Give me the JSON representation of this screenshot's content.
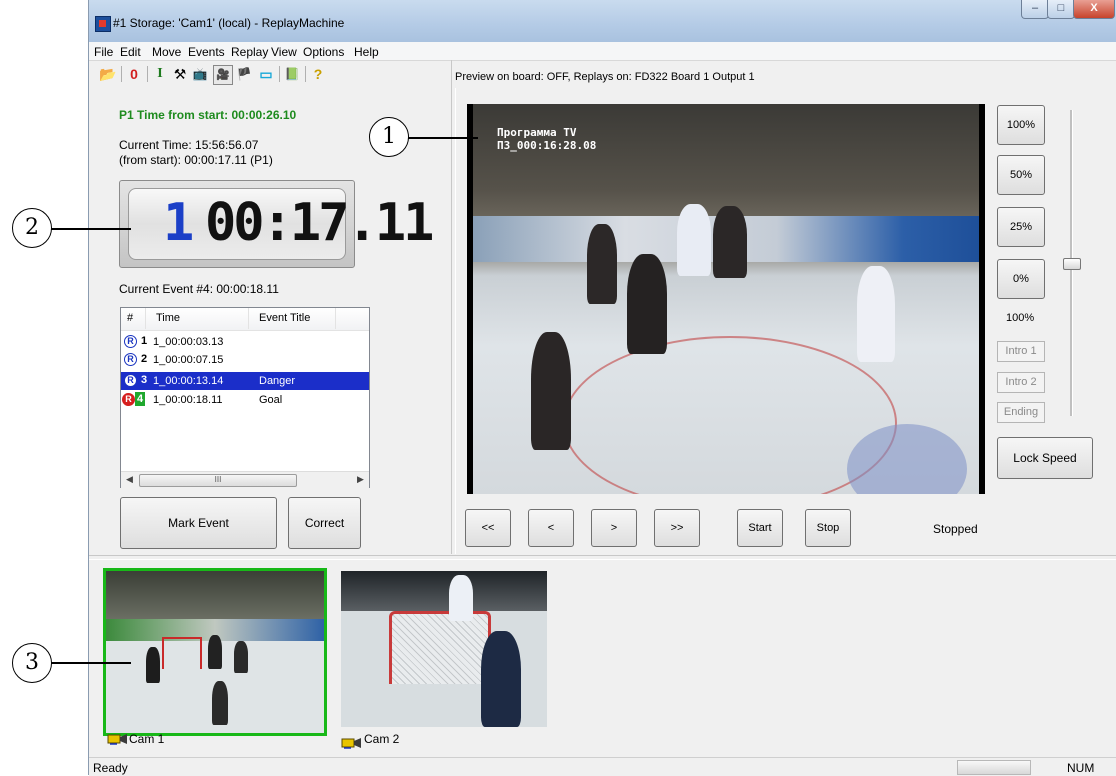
{
  "window": {
    "title": "#1 Storage: 'Cam1' (local) - ReplayMachine",
    "min_label": "–",
    "max_label": "□",
    "close_label": "X"
  },
  "menu": [
    "File",
    "Edit",
    "Move",
    "Events",
    "Replay",
    "View",
    "Options",
    "Help"
  ],
  "toolbar": {
    "icons": [
      "open-folder-icon",
      "record-zero-icon",
      "cursor-i-icon",
      "tools-icon",
      "tv-icon",
      "cam-event-icon",
      "flag-icon",
      "screen-icon",
      "list-icon",
      "help-icon"
    ],
    "open_glyph": "📂",
    "zero_glyph": "0",
    "i_glyph": "I",
    "tools_glyph": "⚒",
    "tv_glyph": "📺",
    "cam_glyph": "🎥",
    "flag_glyph": "🏴",
    "screen_glyph": "▭",
    "list_glyph": "📗",
    "help_glyph": "?"
  },
  "preview_info": "Preview on board: OFF, Replays on: FD322 Board 1 Output 1",
  "left": {
    "p1_time": "P1 Time from start: 00:00:26.10",
    "current_time": "Current Time: 15:56:56.07",
    "from_start": "(from start): 00:00:17.11 (P1)",
    "lcd_player": "1",
    "lcd_time": "00:17.11",
    "current_event": "Current Event #4: 00:00:18.11"
  },
  "events": {
    "headers": [
      "#",
      "Time",
      "Event Title"
    ],
    "rows": [
      {
        "num": "1",
        "time": "1_00:00:03.13",
        "title": ""
      },
      {
        "num": "2",
        "time": "1_00:00:07.15",
        "title": ""
      },
      {
        "num": "3",
        "time": "1_00:00:13.14",
        "title": "Danger"
      },
      {
        "num": "4",
        "time": "1_00:00:18.11",
        "title": "Goal"
      }
    ],
    "scroll_thumb": "III",
    "icon_glyph": "R",
    "selected_row": 3
  },
  "buttons": {
    "mark_event": "Mark Event",
    "correct": "Correct",
    "lock_speed": "Lock Speed"
  },
  "video": {
    "osd_line1": "Программа TV",
    "osd_line2": "П3_000:16:28.08"
  },
  "speed": {
    "buttons": [
      "100%",
      "50%",
      "25%",
      "0%"
    ],
    "current": "100%",
    "slider_level": 1.0,
    "disabled_buttons": [
      "Intro 1",
      "Intro 2",
      "Ending"
    ]
  },
  "nav": {
    "buttons": [
      "<<",
      "<",
      ">",
      ">>",
      "Start",
      "Stop"
    ],
    "status": "Stopped"
  },
  "cameras": [
    {
      "name": "Cam 1",
      "active": true
    },
    {
      "name": "Cam 2",
      "active": false
    }
  ],
  "status_bar": {
    "ready": "Ready",
    "num": "NUM"
  },
  "callouts": [
    "1",
    "2",
    "3"
  ],
  "colors": {
    "accent_green": "#1e8b1e",
    "selection_blue": "#1b2ec9",
    "active_cam_border": "#18b818",
    "lcd_player_blue": "#1b3fc7"
  }
}
